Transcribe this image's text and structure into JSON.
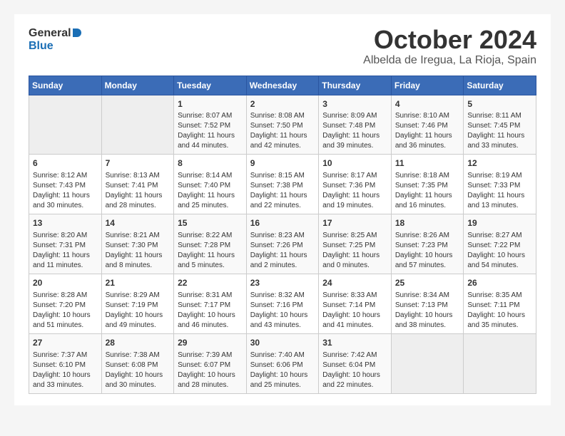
{
  "header": {
    "logo_general": "General",
    "logo_blue": "Blue",
    "month_title": "October 2024",
    "location": "Albelda de Iregua, La Rioja, Spain"
  },
  "days_of_week": [
    "Sunday",
    "Monday",
    "Tuesday",
    "Wednesday",
    "Thursday",
    "Friday",
    "Saturday"
  ],
  "weeks": [
    [
      {
        "day": "",
        "empty": true
      },
      {
        "day": "",
        "empty": true
      },
      {
        "day": "1",
        "sunrise": "Sunrise: 8:07 AM",
        "sunset": "Sunset: 7:52 PM",
        "daylight": "Daylight: 11 hours and 44 minutes."
      },
      {
        "day": "2",
        "sunrise": "Sunrise: 8:08 AM",
        "sunset": "Sunset: 7:50 PM",
        "daylight": "Daylight: 11 hours and 42 minutes."
      },
      {
        "day": "3",
        "sunrise": "Sunrise: 8:09 AM",
        "sunset": "Sunset: 7:48 PM",
        "daylight": "Daylight: 11 hours and 39 minutes."
      },
      {
        "day": "4",
        "sunrise": "Sunrise: 8:10 AM",
        "sunset": "Sunset: 7:46 PM",
        "daylight": "Daylight: 11 hours and 36 minutes."
      },
      {
        "day": "5",
        "sunrise": "Sunrise: 8:11 AM",
        "sunset": "Sunset: 7:45 PM",
        "daylight": "Daylight: 11 hours and 33 minutes."
      }
    ],
    [
      {
        "day": "6",
        "sunrise": "Sunrise: 8:12 AM",
        "sunset": "Sunset: 7:43 PM",
        "daylight": "Daylight: 11 hours and 30 minutes."
      },
      {
        "day": "7",
        "sunrise": "Sunrise: 8:13 AM",
        "sunset": "Sunset: 7:41 PM",
        "daylight": "Daylight: 11 hours and 28 minutes."
      },
      {
        "day": "8",
        "sunrise": "Sunrise: 8:14 AM",
        "sunset": "Sunset: 7:40 PM",
        "daylight": "Daylight: 11 hours and 25 minutes."
      },
      {
        "day": "9",
        "sunrise": "Sunrise: 8:15 AM",
        "sunset": "Sunset: 7:38 PM",
        "daylight": "Daylight: 11 hours and 22 minutes."
      },
      {
        "day": "10",
        "sunrise": "Sunrise: 8:17 AM",
        "sunset": "Sunset: 7:36 PM",
        "daylight": "Daylight: 11 hours and 19 minutes."
      },
      {
        "day": "11",
        "sunrise": "Sunrise: 8:18 AM",
        "sunset": "Sunset: 7:35 PM",
        "daylight": "Daylight: 11 hours and 16 minutes."
      },
      {
        "day": "12",
        "sunrise": "Sunrise: 8:19 AM",
        "sunset": "Sunset: 7:33 PM",
        "daylight": "Daylight: 11 hours and 13 minutes."
      }
    ],
    [
      {
        "day": "13",
        "sunrise": "Sunrise: 8:20 AM",
        "sunset": "Sunset: 7:31 PM",
        "daylight": "Daylight: 11 hours and 11 minutes."
      },
      {
        "day": "14",
        "sunrise": "Sunrise: 8:21 AM",
        "sunset": "Sunset: 7:30 PM",
        "daylight": "Daylight: 11 hours and 8 minutes."
      },
      {
        "day": "15",
        "sunrise": "Sunrise: 8:22 AM",
        "sunset": "Sunset: 7:28 PM",
        "daylight": "Daylight: 11 hours and 5 minutes."
      },
      {
        "day": "16",
        "sunrise": "Sunrise: 8:23 AM",
        "sunset": "Sunset: 7:26 PM",
        "daylight": "Daylight: 11 hours and 2 minutes."
      },
      {
        "day": "17",
        "sunrise": "Sunrise: 8:25 AM",
        "sunset": "Sunset: 7:25 PM",
        "daylight": "Daylight: 11 hours and 0 minutes."
      },
      {
        "day": "18",
        "sunrise": "Sunrise: 8:26 AM",
        "sunset": "Sunset: 7:23 PM",
        "daylight": "Daylight: 10 hours and 57 minutes."
      },
      {
        "day": "19",
        "sunrise": "Sunrise: 8:27 AM",
        "sunset": "Sunset: 7:22 PM",
        "daylight": "Daylight: 10 hours and 54 minutes."
      }
    ],
    [
      {
        "day": "20",
        "sunrise": "Sunrise: 8:28 AM",
        "sunset": "Sunset: 7:20 PM",
        "daylight": "Daylight: 10 hours and 51 minutes."
      },
      {
        "day": "21",
        "sunrise": "Sunrise: 8:29 AM",
        "sunset": "Sunset: 7:19 PM",
        "daylight": "Daylight: 10 hours and 49 minutes."
      },
      {
        "day": "22",
        "sunrise": "Sunrise: 8:31 AM",
        "sunset": "Sunset: 7:17 PM",
        "daylight": "Daylight: 10 hours and 46 minutes."
      },
      {
        "day": "23",
        "sunrise": "Sunrise: 8:32 AM",
        "sunset": "Sunset: 7:16 PM",
        "daylight": "Daylight: 10 hours and 43 minutes."
      },
      {
        "day": "24",
        "sunrise": "Sunrise: 8:33 AM",
        "sunset": "Sunset: 7:14 PM",
        "daylight": "Daylight: 10 hours and 41 minutes."
      },
      {
        "day": "25",
        "sunrise": "Sunrise: 8:34 AM",
        "sunset": "Sunset: 7:13 PM",
        "daylight": "Daylight: 10 hours and 38 minutes."
      },
      {
        "day": "26",
        "sunrise": "Sunrise: 8:35 AM",
        "sunset": "Sunset: 7:11 PM",
        "daylight": "Daylight: 10 hours and 35 minutes."
      }
    ],
    [
      {
        "day": "27",
        "sunrise": "Sunrise: 7:37 AM",
        "sunset": "Sunset: 6:10 PM",
        "daylight": "Daylight: 10 hours and 33 minutes."
      },
      {
        "day": "28",
        "sunrise": "Sunrise: 7:38 AM",
        "sunset": "Sunset: 6:08 PM",
        "daylight": "Daylight: 10 hours and 30 minutes."
      },
      {
        "day": "29",
        "sunrise": "Sunrise: 7:39 AM",
        "sunset": "Sunset: 6:07 PM",
        "daylight": "Daylight: 10 hours and 28 minutes."
      },
      {
        "day": "30",
        "sunrise": "Sunrise: 7:40 AM",
        "sunset": "Sunset: 6:06 PM",
        "daylight": "Daylight: 10 hours and 25 minutes."
      },
      {
        "day": "31",
        "sunrise": "Sunrise: 7:42 AM",
        "sunset": "Sunset: 6:04 PM",
        "daylight": "Daylight: 10 hours and 22 minutes."
      },
      {
        "day": "",
        "empty": true
      },
      {
        "day": "",
        "empty": true
      }
    ]
  ]
}
